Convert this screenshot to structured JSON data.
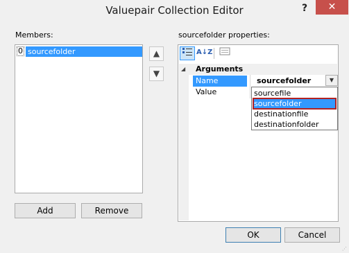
{
  "window": {
    "title": "Valuepair Collection Editor",
    "help_glyph": "?",
    "close_glyph": "✕"
  },
  "members": {
    "label": "Members:",
    "items": [
      {
        "index": "0",
        "name": "sourcefolder",
        "selected": true
      }
    ],
    "move_up_icon": "▲",
    "move_down_icon": "▼",
    "add_label": "Add",
    "remove_label": "Remove"
  },
  "properties": {
    "label": "sourcefolder properties:",
    "toolbar": {
      "categorized_icon": "categorized-icon",
      "alphabetical_label": "A↓Z",
      "property_pages_icon": "property-pages-icon"
    },
    "category": "Arguments",
    "rows": [
      {
        "name": "Name",
        "value": "sourcefolder",
        "selected": true
      },
      {
        "name": "Value",
        "value": "",
        "selected": false
      }
    ],
    "dropdown_options": [
      "sourcefile",
      "sourcefolder",
      "destinationfile",
      "destinationfolder"
    ],
    "dropdown_selected": "sourcefolder"
  },
  "footer": {
    "ok_label": "OK",
    "cancel_label": "Cancel"
  },
  "colors": {
    "selection": "#3399ff",
    "highlight_outline": "#b22222",
    "close_button": "#c7504b"
  }
}
